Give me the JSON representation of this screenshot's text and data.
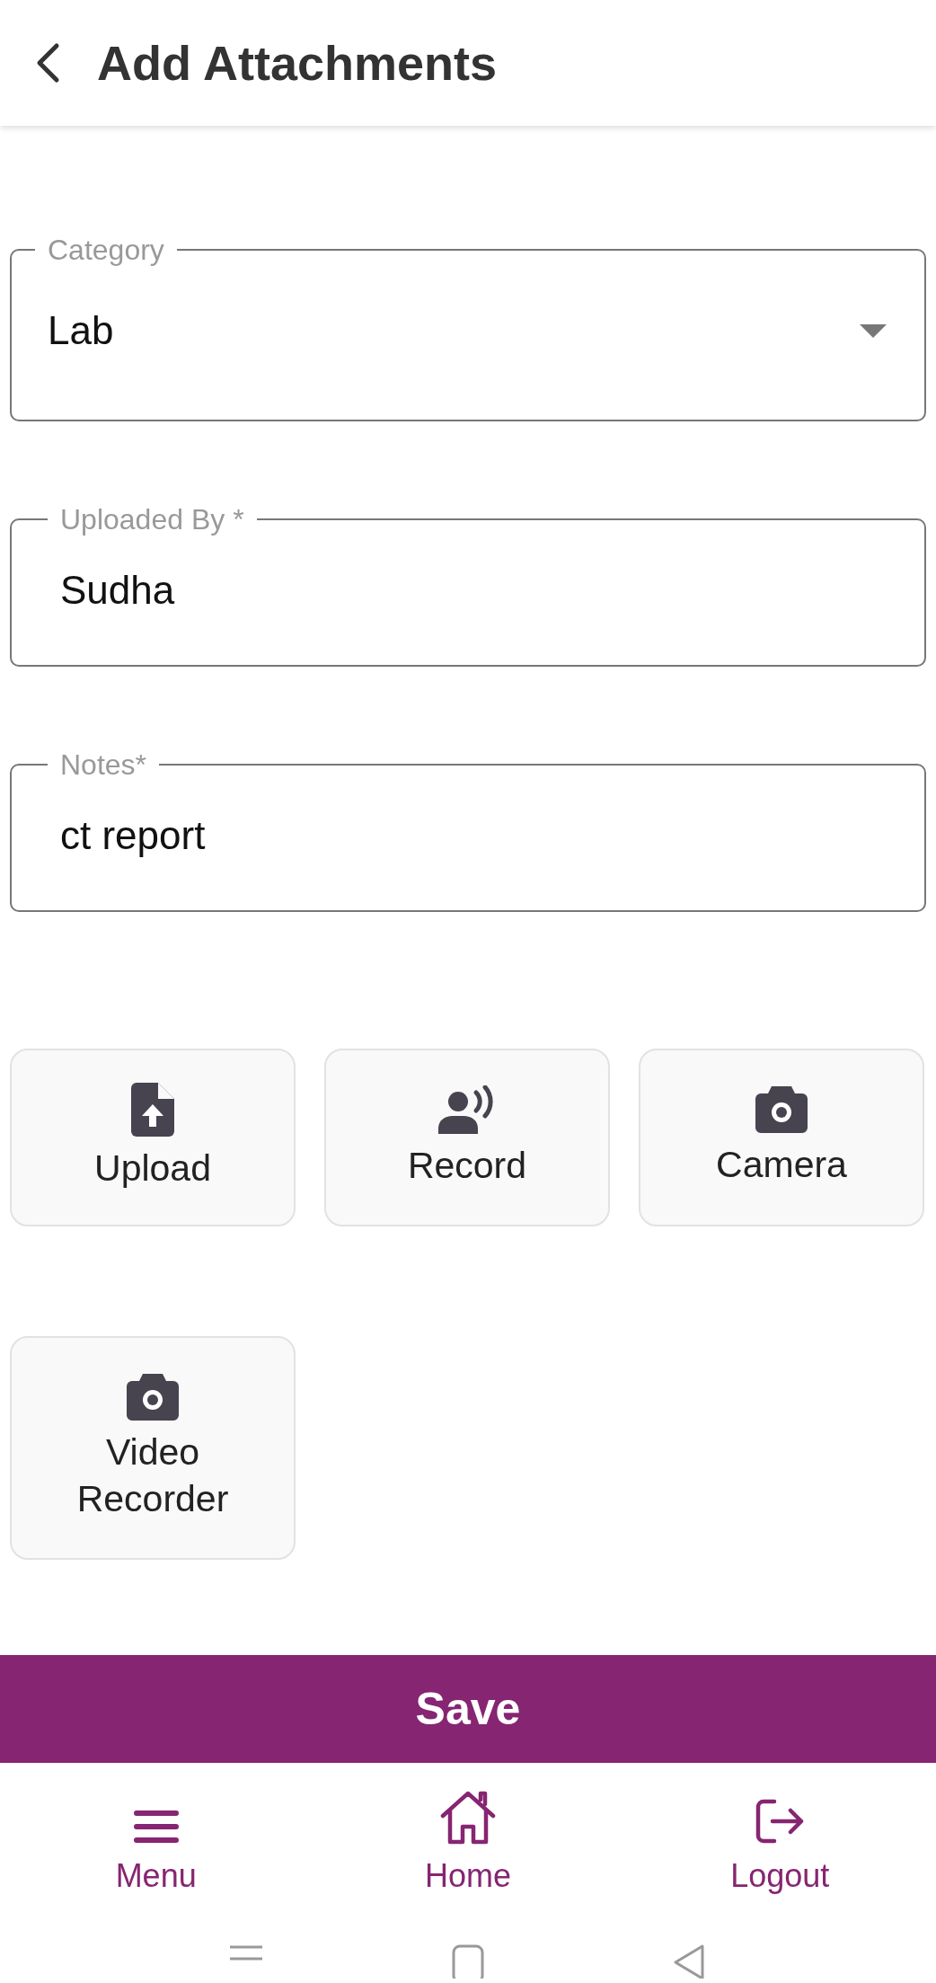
{
  "header": {
    "title": "Add Attachments"
  },
  "fields": [
    {
      "kind": "select",
      "label": "Category",
      "value": "Lab"
    },
    {
      "kind": "text",
      "label": "Uploaded By *",
      "value": "Sudha"
    },
    {
      "kind": "text",
      "label": "Notes*",
      "value": "ct report"
    }
  ],
  "attachment_buttons": [
    {
      "kind": "upload",
      "label": "Upload"
    },
    {
      "kind": "record",
      "label": "Record"
    },
    {
      "kind": "camera",
      "label": "Camera"
    },
    {
      "kind": "video",
      "label": "Video Recorder"
    }
  ],
  "save_button": "Save",
  "bottom_nav": [
    {
      "kind": "menu",
      "label": "Menu"
    },
    {
      "kind": "home",
      "label": "Home"
    },
    {
      "kind": "logout",
      "label": "Logout"
    }
  ]
}
